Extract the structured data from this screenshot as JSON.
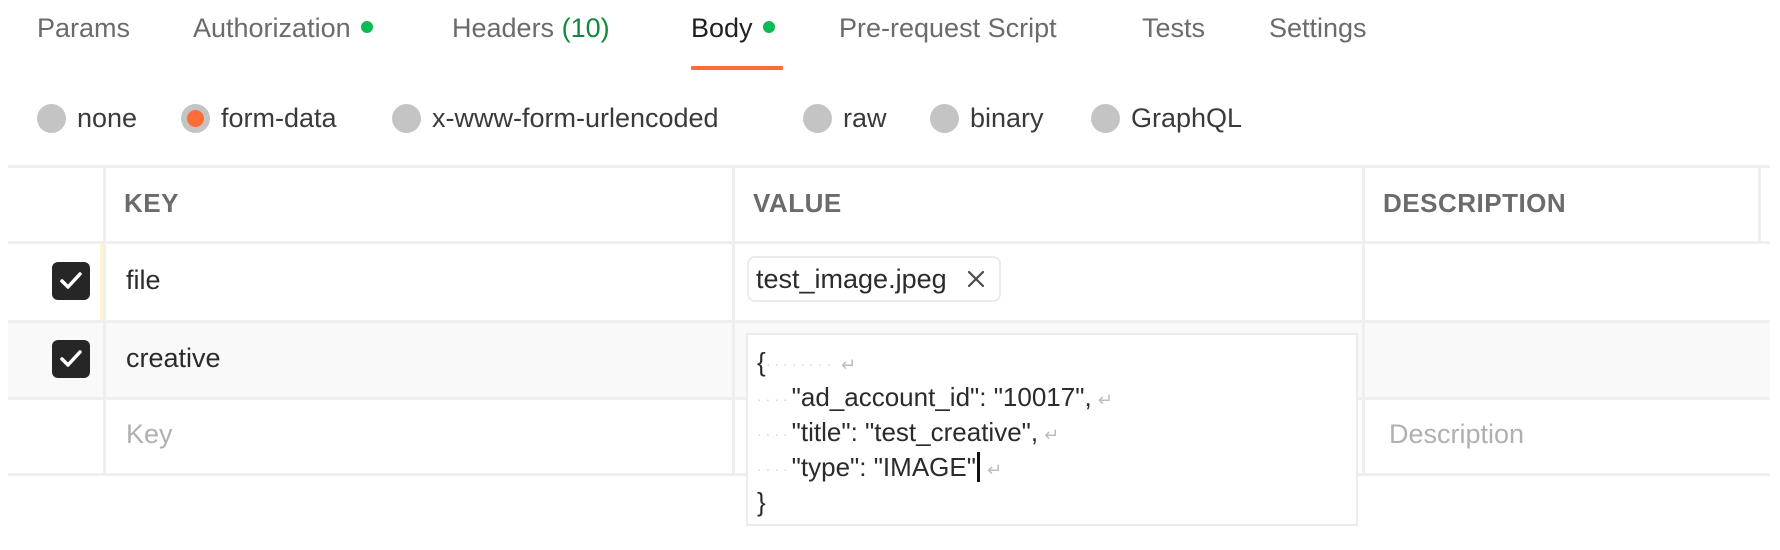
{
  "tabs": [
    {
      "label": "Params",
      "active": false
    },
    {
      "label": "Authorization",
      "active": false,
      "indicator": "green-dot"
    },
    {
      "label": "Headers",
      "count": "(10)",
      "active": false
    },
    {
      "label": "Body",
      "active": true,
      "indicator": "green-dot"
    },
    {
      "label": "Pre-request Script",
      "active": false
    },
    {
      "label": "Tests",
      "active": false
    },
    {
      "label": "Settings",
      "active": false
    }
  ],
  "body_types": [
    {
      "label": "none",
      "selected": false
    },
    {
      "label": "form-data",
      "selected": true
    },
    {
      "label": "x-www-form-urlencoded",
      "selected": false
    },
    {
      "label": "raw",
      "selected": false
    },
    {
      "label": "binary",
      "selected": false
    },
    {
      "label": "GraphQL",
      "selected": false
    }
  ],
  "table": {
    "headers": {
      "key": "KEY",
      "value": "VALUE",
      "description": "DESCRIPTION"
    },
    "rows": [
      {
        "checked": true,
        "key": "file",
        "value_type": "file",
        "file_name": "test_image.jpeg",
        "description": ""
      },
      {
        "checked": true,
        "key": "creative",
        "value_type": "text",
        "description": ""
      }
    ],
    "new_row": {
      "key_placeholder": "Key",
      "description_placeholder": "Description"
    }
  },
  "editor": {
    "lines": [
      "{",
      "\"ad_account_id\": \"10017\",",
      "\"title\": \"test_creative\",",
      "\"type\": \"IMAGE\"",
      "}"
    ]
  },
  "colors": {
    "accent": "#ff6c37",
    "status_green": "#0cbb52",
    "count_green": "#0f8a3c",
    "checkbox": "#262626"
  }
}
